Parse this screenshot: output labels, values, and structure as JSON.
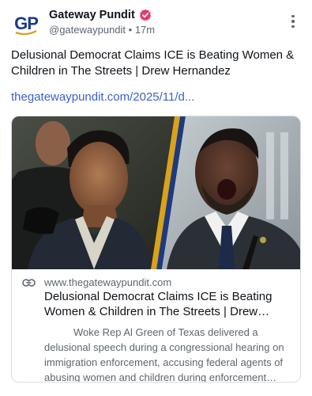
{
  "author": {
    "display_name": "Gateway Pundit",
    "handle": "@gatewaypundit",
    "time": "17m",
    "avatar_letters": "GP"
  },
  "icons": {
    "verified": "verified-badge-icon",
    "menu": "more-vertical-icon",
    "link": "link-icon"
  },
  "post": {
    "text": "Delusional Democrat Claims ICE is Beating Women & Children in The Streets | Drew Hernandez",
    "link_text": "thegatewaypundit.com/2025/11/d..."
  },
  "card": {
    "domain": "www.thegatewaypundit.com",
    "title": "Delusional Democrat Claims ICE is Beating Women & Children in The Streets | Drew Hernandez",
    "description": "Woke Rep Al Green of Texas delivered a delusional speech during a congressional hearing on immigration enforcement, accusing federal agents of abusing women and children during enforcement operations."
  },
  "colors": {
    "brand_blue": "#1a3a8f",
    "brand_gold": "#d8a21b",
    "verified": "#e53a6f",
    "link": "#3a62c9",
    "muted": "#5c6670"
  }
}
